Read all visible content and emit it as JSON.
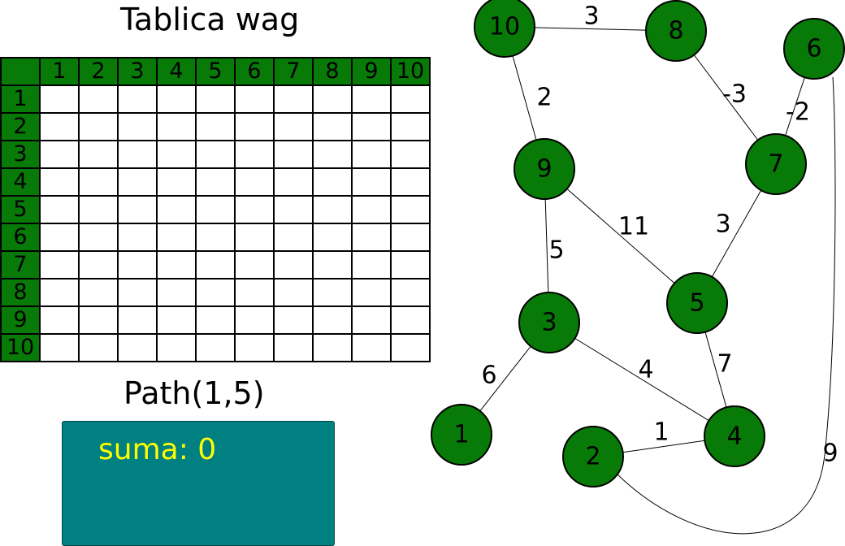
{
  "weights_table": {
    "title": "Tablica wag",
    "column_headers": [
      "1",
      "2",
      "3",
      "4",
      "5",
      "6",
      "7",
      "8",
      "9",
      "10"
    ],
    "row_headers": [
      "1",
      "2",
      "3",
      "4",
      "5",
      "6",
      "7",
      "8",
      "9",
      "10"
    ]
  },
  "path": {
    "title": "Path(1,5)",
    "sum_label": "suma: 0"
  },
  "graph": {
    "node_color": "#087a08",
    "nodes": [
      {
        "id": "1",
        "label": "1"
      },
      {
        "id": "2",
        "label": "2"
      },
      {
        "id": "3",
        "label": "3"
      },
      {
        "id": "4",
        "label": "4"
      },
      {
        "id": "5",
        "label": "5"
      },
      {
        "id": "6",
        "label": "6"
      },
      {
        "id": "7",
        "label": "7"
      },
      {
        "id": "8",
        "label": "8"
      },
      {
        "id": "9",
        "label": "9"
      },
      {
        "id": "10",
        "label": "10"
      }
    ],
    "edges": [
      {
        "from": "10",
        "to": "8",
        "weight": "3"
      },
      {
        "from": "10",
        "to": "9",
        "weight": "2"
      },
      {
        "from": "8",
        "to": "7",
        "weight": "-3"
      },
      {
        "from": "6",
        "to": "7",
        "weight": "-2"
      },
      {
        "from": "9",
        "to": "5",
        "weight": "11"
      },
      {
        "from": "7",
        "to": "5",
        "weight": "3"
      },
      {
        "from": "9",
        "to": "3",
        "weight": "5"
      },
      {
        "from": "3",
        "to": "1",
        "weight": "6"
      },
      {
        "from": "3",
        "to": "4",
        "weight": "4"
      },
      {
        "from": "5",
        "to": "4",
        "weight": "7"
      },
      {
        "from": "2",
        "to": "4",
        "weight": "1"
      },
      {
        "from": "2",
        "to": "6",
        "weight": "9"
      }
    ]
  }
}
